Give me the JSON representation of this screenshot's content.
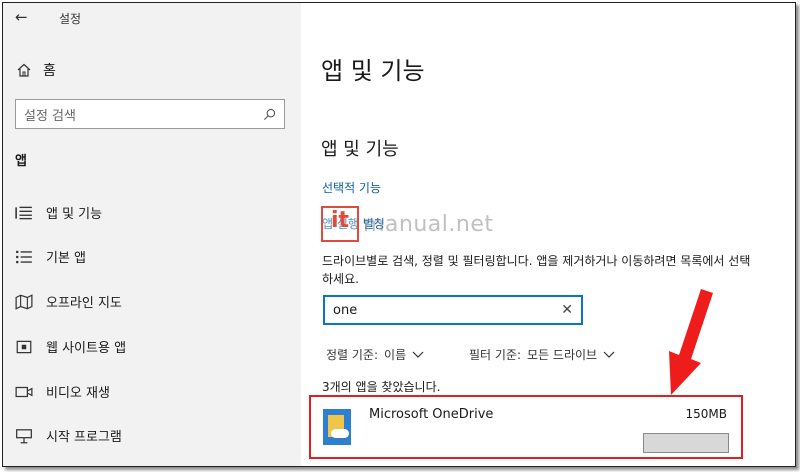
{
  "window": {
    "title": "설정"
  },
  "sidebar": {
    "home_label": "홈",
    "search_placeholder": "설정 검색",
    "section_label": "앱",
    "items": [
      {
        "label": "앱 및 기능",
        "icon": "apps-features-icon"
      },
      {
        "label": "기본 앱",
        "icon": "default-apps-icon"
      },
      {
        "label": "오프라인 지도",
        "icon": "offline-maps-icon"
      },
      {
        "label": "웹 사이트용 앱",
        "icon": "apps-for-websites-icon"
      },
      {
        "label": "비디오 재생",
        "icon": "video-playback-icon"
      },
      {
        "label": "시작 프로그램",
        "icon": "startup-icon"
      }
    ]
  },
  "main": {
    "page_title": "앱 및 기능",
    "section_title": "앱 및 기능",
    "link_optional_features": "선택적 기능",
    "link_app_execution_alias": "앱 실행 별칭",
    "description": "드라이브별로 검색, 정렬 및 필터링합니다. 앱을 제거하거나 이동하려면 목록에서 선택하세요.",
    "search_value": "one",
    "sort_label": "정렬 기준:",
    "sort_value": "이름",
    "filter_label": "필터 기준:",
    "filter_value": "모든 드라이브",
    "found_text": "3개의 앱을 찾았습니다.",
    "apps": [
      {
        "name": "Microsoft OneDrive",
        "size": "150MB"
      }
    ]
  },
  "watermark": {
    "mark": "it",
    "text": "manual.net"
  },
  "colors": {
    "accent": "#0a75cf",
    "link": "#0a5fa6",
    "highlight": "#e02020"
  }
}
